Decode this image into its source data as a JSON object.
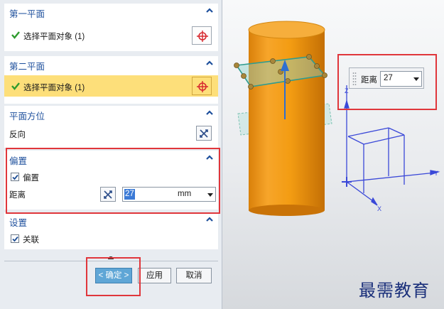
{
  "sections": {
    "first_plane": {
      "title": "第一平面",
      "select_label": "选择平面对象 (1)"
    },
    "second_plane": {
      "title": "第二平面",
      "select_label": "选择平面对象 (1)"
    },
    "orientation": {
      "title": "平面方位",
      "reverse_label": "反向"
    },
    "offset": {
      "title": "偏置",
      "offset_checkbox_label": "偏置",
      "distance_label": "距离",
      "distance_value": "27",
      "distance_unit": "mm"
    },
    "settings": {
      "title": "设置",
      "associative_label": "关联"
    }
  },
  "footer": {
    "ok_label": "< 确定 >",
    "apply_label": "应用",
    "cancel_label": "取消"
  },
  "viewport": {
    "float_label": "距离",
    "float_value": "27",
    "axis_labels": {
      "z": "Z",
      "y": "Y",
      "x": "X"
    }
  },
  "watermark": "最需教育",
  "colors": {
    "section_title": "#1d4f9c",
    "highlight": "#fddf7a",
    "annotation": "#e0363b",
    "cylinder": "#f39c12",
    "ok_button": "#5fa6d6"
  },
  "icons": {
    "selection": "crosshair-icon",
    "reverse": "reverse-direction-icon",
    "collapse": "chevron-up-icon",
    "check": "check-icon"
  }
}
